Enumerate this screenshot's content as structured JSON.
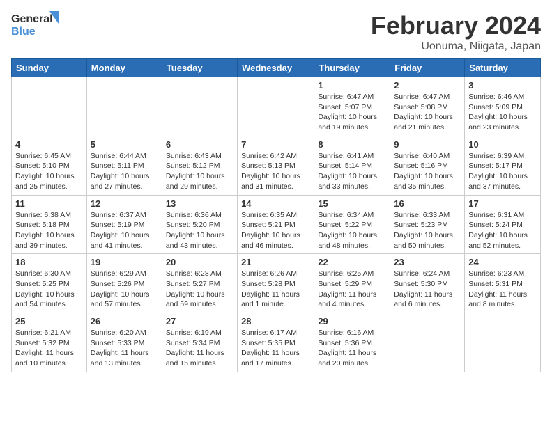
{
  "header": {
    "logo_line1": "General",
    "logo_line2": "Blue",
    "title": "February 2024",
    "subtitle": "Uonuma, Niigata, Japan"
  },
  "weekdays": [
    "Sunday",
    "Monday",
    "Tuesday",
    "Wednesday",
    "Thursday",
    "Friday",
    "Saturday"
  ],
  "weeks": [
    [
      {
        "num": "",
        "info": ""
      },
      {
        "num": "",
        "info": ""
      },
      {
        "num": "",
        "info": ""
      },
      {
        "num": "",
        "info": ""
      },
      {
        "num": "1",
        "info": "Sunrise: 6:47 AM\nSunset: 5:07 PM\nDaylight: 10 hours\nand 19 minutes."
      },
      {
        "num": "2",
        "info": "Sunrise: 6:47 AM\nSunset: 5:08 PM\nDaylight: 10 hours\nand 21 minutes."
      },
      {
        "num": "3",
        "info": "Sunrise: 6:46 AM\nSunset: 5:09 PM\nDaylight: 10 hours\nand 23 minutes."
      }
    ],
    [
      {
        "num": "4",
        "info": "Sunrise: 6:45 AM\nSunset: 5:10 PM\nDaylight: 10 hours\nand 25 minutes."
      },
      {
        "num": "5",
        "info": "Sunrise: 6:44 AM\nSunset: 5:11 PM\nDaylight: 10 hours\nand 27 minutes."
      },
      {
        "num": "6",
        "info": "Sunrise: 6:43 AM\nSunset: 5:12 PM\nDaylight: 10 hours\nand 29 minutes."
      },
      {
        "num": "7",
        "info": "Sunrise: 6:42 AM\nSunset: 5:13 PM\nDaylight: 10 hours\nand 31 minutes."
      },
      {
        "num": "8",
        "info": "Sunrise: 6:41 AM\nSunset: 5:14 PM\nDaylight: 10 hours\nand 33 minutes."
      },
      {
        "num": "9",
        "info": "Sunrise: 6:40 AM\nSunset: 5:16 PM\nDaylight: 10 hours\nand 35 minutes."
      },
      {
        "num": "10",
        "info": "Sunrise: 6:39 AM\nSunset: 5:17 PM\nDaylight: 10 hours\nand 37 minutes."
      }
    ],
    [
      {
        "num": "11",
        "info": "Sunrise: 6:38 AM\nSunset: 5:18 PM\nDaylight: 10 hours\nand 39 minutes."
      },
      {
        "num": "12",
        "info": "Sunrise: 6:37 AM\nSunset: 5:19 PM\nDaylight: 10 hours\nand 41 minutes."
      },
      {
        "num": "13",
        "info": "Sunrise: 6:36 AM\nSunset: 5:20 PM\nDaylight: 10 hours\nand 43 minutes."
      },
      {
        "num": "14",
        "info": "Sunrise: 6:35 AM\nSunset: 5:21 PM\nDaylight: 10 hours\nand 46 minutes."
      },
      {
        "num": "15",
        "info": "Sunrise: 6:34 AM\nSunset: 5:22 PM\nDaylight: 10 hours\nand 48 minutes."
      },
      {
        "num": "16",
        "info": "Sunrise: 6:33 AM\nSunset: 5:23 PM\nDaylight: 10 hours\nand 50 minutes."
      },
      {
        "num": "17",
        "info": "Sunrise: 6:31 AM\nSunset: 5:24 PM\nDaylight: 10 hours\nand 52 minutes."
      }
    ],
    [
      {
        "num": "18",
        "info": "Sunrise: 6:30 AM\nSunset: 5:25 PM\nDaylight: 10 hours\nand 54 minutes."
      },
      {
        "num": "19",
        "info": "Sunrise: 6:29 AM\nSunset: 5:26 PM\nDaylight: 10 hours\nand 57 minutes."
      },
      {
        "num": "20",
        "info": "Sunrise: 6:28 AM\nSunset: 5:27 PM\nDaylight: 10 hours\nand 59 minutes."
      },
      {
        "num": "21",
        "info": "Sunrise: 6:26 AM\nSunset: 5:28 PM\nDaylight: 11 hours\nand 1 minute."
      },
      {
        "num": "22",
        "info": "Sunrise: 6:25 AM\nSunset: 5:29 PM\nDaylight: 11 hours\nand 4 minutes."
      },
      {
        "num": "23",
        "info": "Sunrise: 6:24 AM\nSunset: 5:30 PM\nDaylight: 11 hours\nand 6 minutes."
      },
      {
        "num": "24",
        "info": "Sunrise: 6:23 AM\nSunset: 5:31 PM\nDaylight: 11 hours\nand 8 minutes."
      }
    ],
    [
      {
        "num": "25",
        "info": "Sunrise: 6:21 AM\nSunset: 5:32 PM\nDaylight: 11 hours\nand 10 minutes."
      },
      {
        "num": "26",
        "info": "Sunrise: 6:20 AM\nSunset: 5:33 PM\nDaylight: 11 hours\nand 13 minutes."
      },
      {
        "num": "27",
        "info": "Sunrise: 6:19 AM\nSunset: 5:34 PM\nDaylight: 11 hours\nand 15 minutes."
      },
      {
        "num": "28",
        "info": "Sunrise: 6:17 AM\nSunset: 5:35 PM\nDaylight: 11 hours\nand 17 minutes."
      },
      {
        "num": "29",
        "info": "Sunrise: 6:16 AM\nSunset: 5:36 PM\nDaylight: 11 hours\nand 20 minutes."
      },
      {
        "num": "",
        "info": ""
      },
      {
        "num": "",
        "info": ""
      }
    ]
  ]
}
